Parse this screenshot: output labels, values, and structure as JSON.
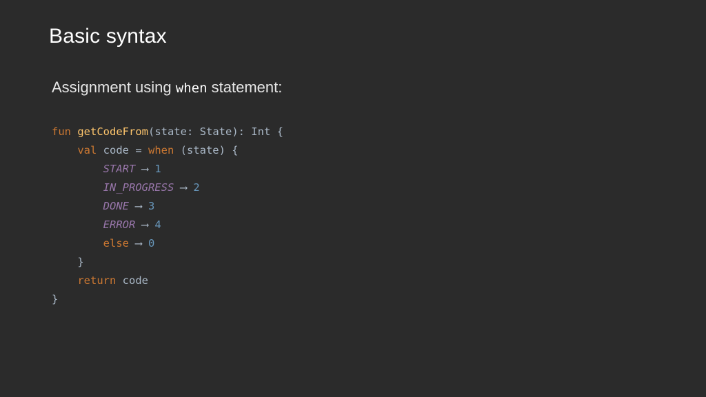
{
  "slide": {
    "title": "Basic syntax",
    "subtitle_before": "Assignment using ",
    "subtitle_code": "when",
    "subtitle_after": " statement:"
  },
  "code": {
    "line1": {
      "kw_fun": "fun",
      "fn_name": "getCodeFrom",
      "rest": "(state: State): Int {"
    },
    "line2": {
      "indent": "    ",
      "kw_val": "val",
      "mid": " code = ",
      "kw_when": "when",
      "rest": " (state) {"
    },
    "branches": [
      {
        "indent": "        ",
        "label": "START",
        "pad": " ",
        "arrow": "⟶",
        "value": "1",
        "label_type": "enum"
      },
      {
        "indent": "        ",
        "label": "IN_PROGRESS",
        "pad": " ",
        "arrow": "⟶",
        "value": "2",
        "label_type": "enum"
      },
      {
        "indent": "        ",
        "label": "DONE",
        "pad": " ",
        "arrow": "⟶",
        "value": "3",
        "label_type": "enum"
      },
      {
        "indent": "        ",
        "label": "ERROR",
        "pad": " ",
        "arrow": "⟶",
        "value": "4",
        "label_type": "enum"
      },
      {
        "indent": "        ",
        "label": "else",
        "pad": " ",
        "arrow": "⟶",
        "value": "0",
        "label_type": "keyword"
      }
    ],
    "line_close_when": {
      "indent": "    ",
      "text": "}"
    },
    "line_return": {
      "indent": "    ",
      "kw_return": "return",
      "rest": " code"
    },
    "line_close_fun": {
      "text": "}"
    }
  }
}
